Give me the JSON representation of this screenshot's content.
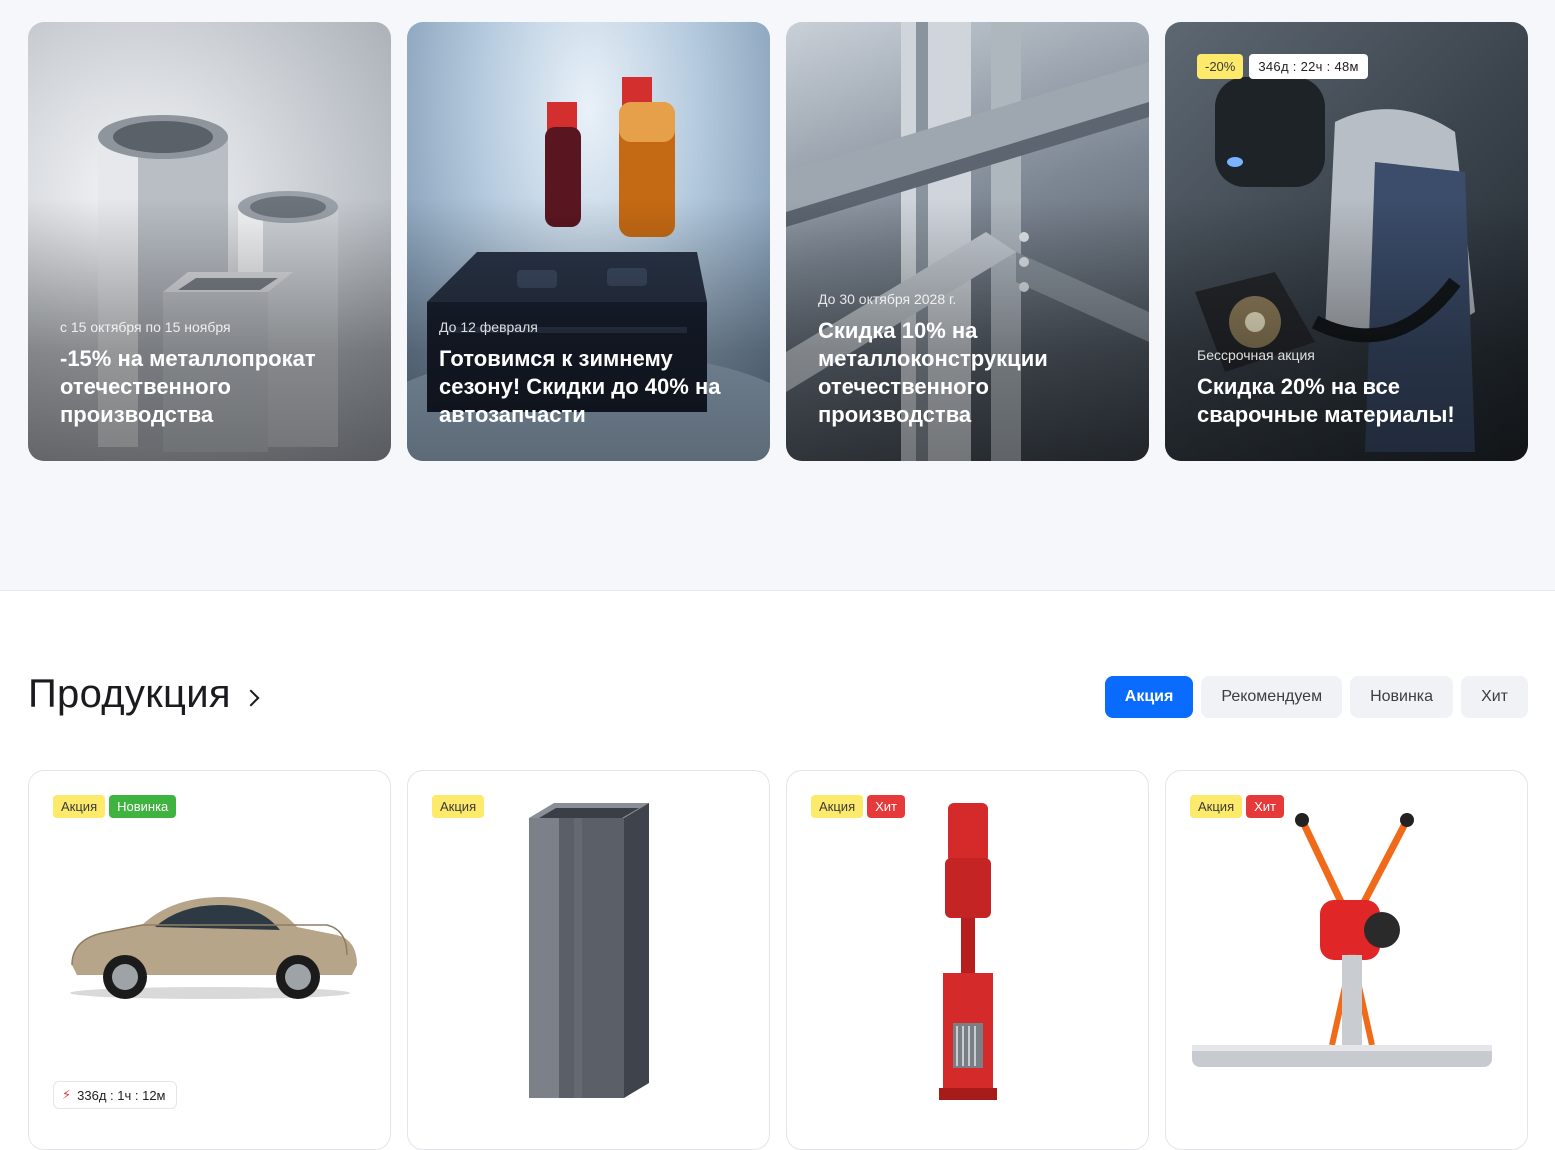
{
  "promos": [
    {
      "date": "с 15 октября по 15 ноября",
      "title": "-15% на металлопрокат отечественного производства"
    },
    {
      "date": "До 12 февраля",
      "title": "Готовимся к зимнему сезону! Скидки до 40% на автозапчасти"
    },
    {
      "date": "До 30 октября 2028 г.",
      "title": "Скидка 10% на металлоконструкции отечественного производства"
    },
    {
      "date": "Бессрочная акция",
      "title": "Скидка 20% на все сварочные материалы!",
      "discount": "-20%",
      "timer": "346д : 22ч : 48м"
    }
  ],
  "products_section": {
    "title": "Продукция",
    "tabs": [
      "Акция",
      "Рекомендуем",
      "Новинка",
      "Хит"
    ],
    "active_tab": "Акция"
  },
  "products": [
    {
      "tags": [
        "Акция",
        "Новинка"
      ],
      "image": "car",
      "timer": "336д : 1ч : 12м"
    },
    {
      "tags": [
        "Акция"
      ],
      "image": "steel-profile-pipe"
    },
    {
      "tags": [
        "Акция",
        "Хит"
      ],
      "image": "industrial-pump"
    },
    {
      "tags": [
        "Акция",
        "Хит"
      ],
      "image": "concrete-screed-machine"
    }
  ],
  "colors": {
    "accent": "#0a6cff",
    "tag_sale": "#fde96a",
    "tag_new": "#3fb33f",
    "tag_hit": "#e63a3a"
  }
}
